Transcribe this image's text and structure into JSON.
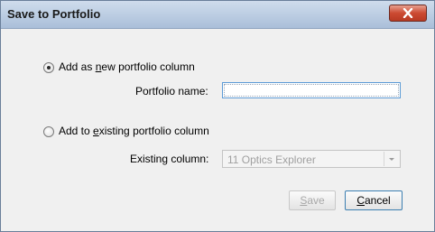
{
  "window": {
    "title": "Save to Portfolio"
  },
  "options": {
    "new_column": {
      "prefix": "Add as ",
      "mnemonic": "n",
      "suffix": "ew portfolio column",
      "selected": true
    },
    "existing_column": {
      "prefix": "Add to ",
      "mnemonic": "e",
      "suffix": "xisting portfolio column",
      "selected": false
    }
  },
  "portfolio_name": {
    "label": "Portfolio name:",
    "value": ""
  },
  "existing_column": {
    "label": "Existing column:",
    "selected": "11 Optics Explorer"
  },
  "buttons": {
    "save": {
      "mnemonic": "S",
      "rest": "ave",
      "enabled": false
    },
    "cancel": {
      "mnemonic": "C",
      "rest": "ancel"
    }
  },
  "icons": {
    "close": "close-x-icon",
    "dropdown": "chevron-down-icon"
  },
  "colors": {
    "titlebar": "#b9cbe1",
    "close_button": "#cc4a32",
    "focus_border": "#5c9bd6"
  }
}
